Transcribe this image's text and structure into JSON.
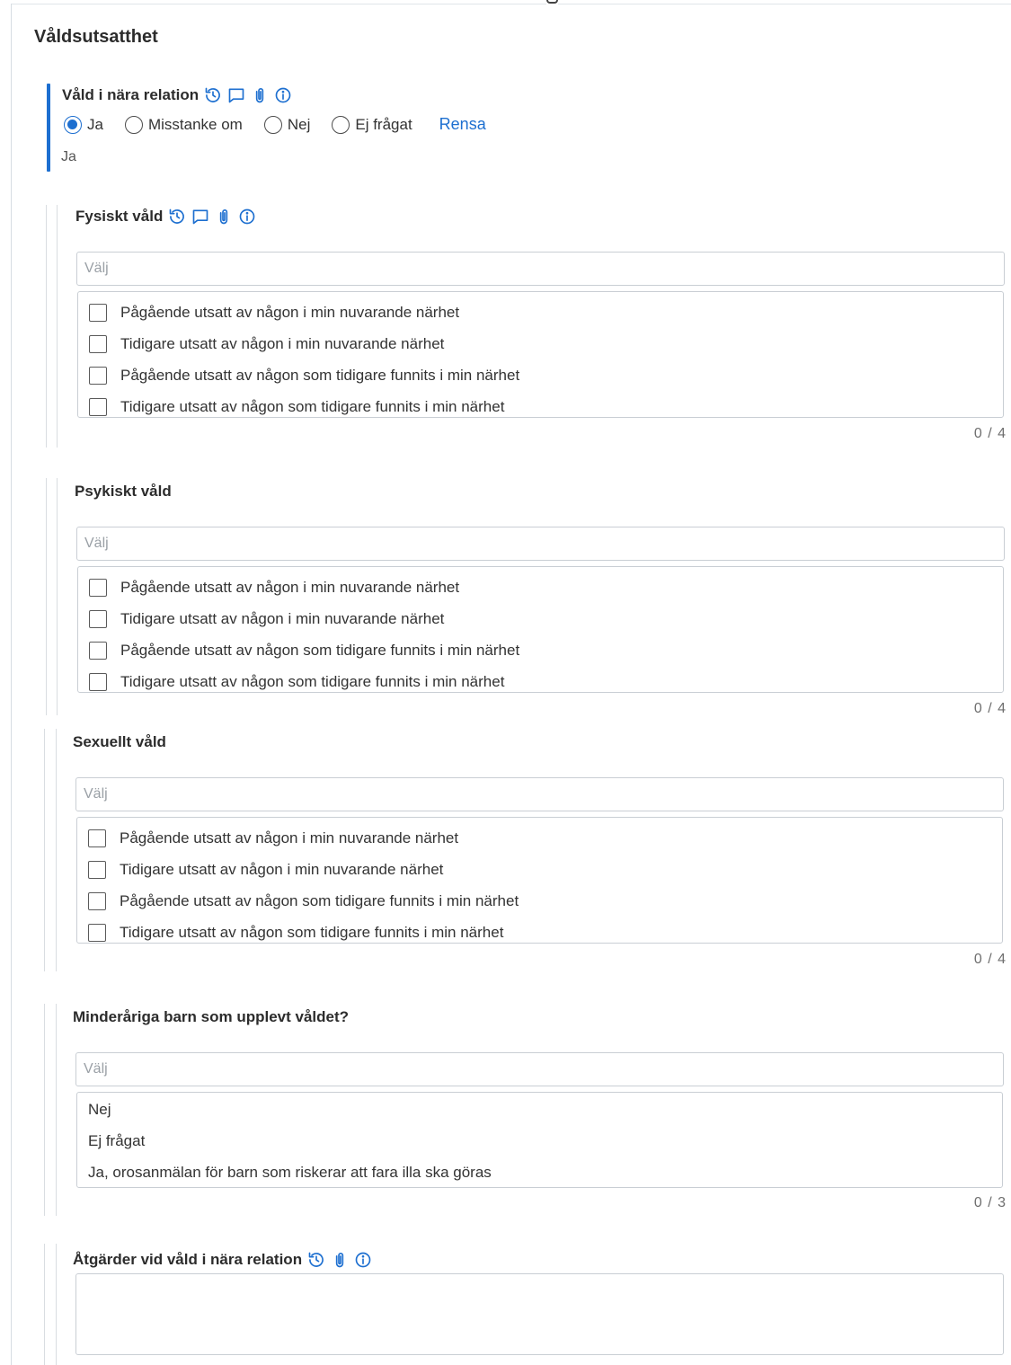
{
  "section": {
    "title": "Våldsutsatthet"
  },
  "vald_nara_relation": {
    "label": "Våld i nära relation",
    "options": [
      "Ja",
      "Misstanke om",
      "Nej",
      "Ej frågat"
    ],
    "selected": "Ja",
    "clear_label": "Rensa",
    "value": "Ja",
    "icons": [
      "history-icon",
      "comment-icon",
      "attachment-icon",
      "info-icon"
    ]
  },
  "fysiskt": {
    "label": "Fysiskt våld",
    "placeholder": "Välj",
    "options": [
      "Pågående utsatt av någon i min nuvarande närhet",
      "Tidigare utsatt av någon i min nuvarande närhet",
      "Pågående utsatt av någon som tidigare funnits i min närhet",
      "Tidigare utsatt av någon som tidigare funnits i min närhet"
    ],
    "counter": "0 / 4",
    "icons": [
      "history-icon",
      "comment-icon",
      "attachment-icon",
      "info-icon"
    ]
  },
  "psykiskt": {
    "label": "Psykiskt våld",
    "placeholder": "Välj",
    "options": [
      "Pågående utsatt av någon i min nuvarande närhet",
      "Tidigare utsatt av någon i min nuvarande närhet",
      "Pågående utsatt av någon som tidigare funnits i min närhet",
      "Tidigare utsatt av någon som tidigare funnits i min närhet"
    ],
    "counter": "0 / 4"
  },
  "sexuellt": {
    "label": "Sexuellt våld",
    "placeholder": "Välj",
    "options": [
      "Pågående utsatt av någon i min nuvarande närhet",
      "Tidigare utsatt av någon i min nuvarande närhet",
      "Pågående utsatt av någon som tidigare funnits i min närhet",
      "Tidigare utsatt av någon som tidigare funnits i min närhet"
    ],
    "counter": "0 / 4"
  },
  "barn": {
    "label": "Minderåriga barn som upplevt våldet?",
    "placeholder": "Välj",
    "options": [
      "Nej",
      "Ej frågat",
      "Ja, orosanmälan för barn som riskerar att fara illa ska göras"
    ],
    "counter": "0 / 3"
  },
  "atgarder": {
    "label": "Åtgärder vid våld i nära relation",
    "value": "",
    "icons": [
      "history-icon",
      "attachment-icon",
      "info-icon"
    ]
  },
  "colors": {
    "accent": "#1d6fd0",
    "border": "#c9ced4",
    "text": "#333333"
  }
}
